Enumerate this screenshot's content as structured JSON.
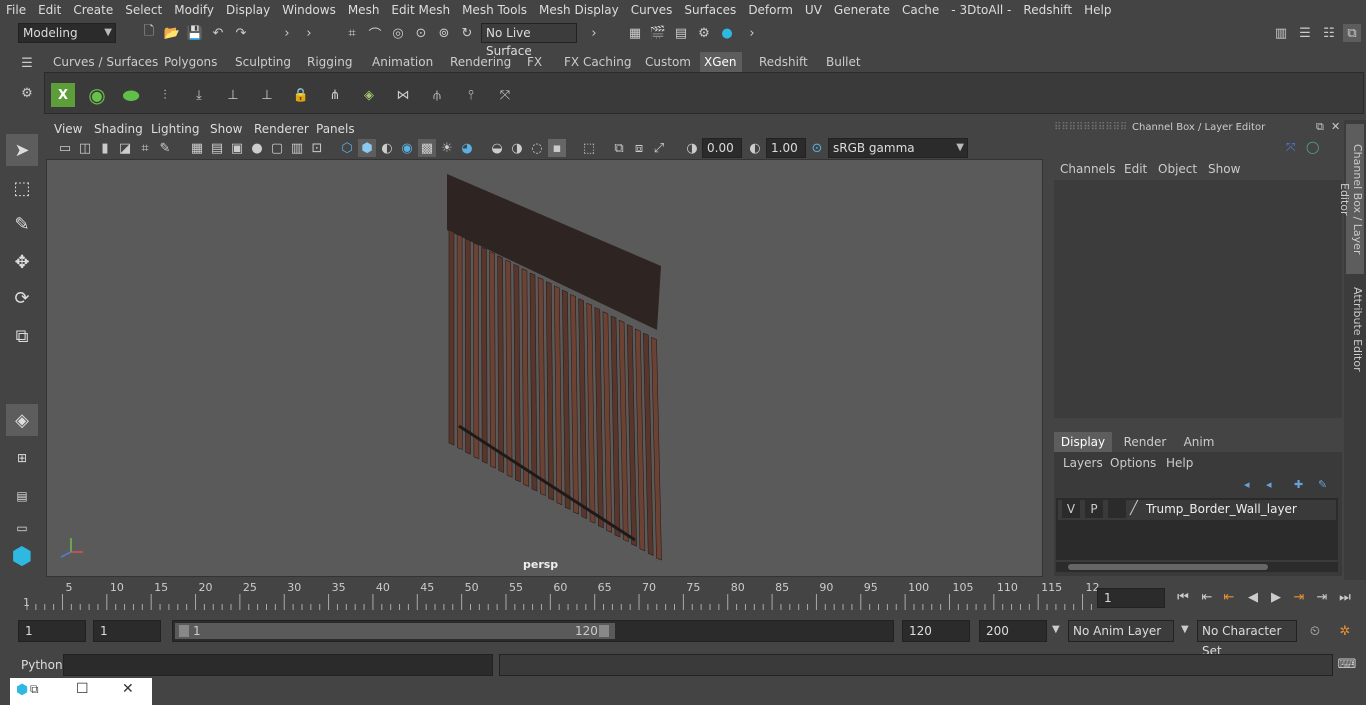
{
  "menubar": [
    "File",
    "Edit",
    "Create",
    "Select",
    "Modify",
    "Display",
    "Windows",
    "Mesh",
    "Edit Mesh",
    "Mesh Tools",
    "Mesh Display",
    "Curves",
    "Surfaces",
    "Deform",
    "UV",
    "Generate",
    "Cache",
    "- 3DtoAll -",
    "Redshift",
    "Help"
  ],
  "status": {
    "mode": "Modeling",
    "live_surface": "No Live Surface"
  },
  "shelf_tabs": [
    "Curves / Surfaces",
    "Polygons",
    "Sculpting",
    "Rigging",
    "Animation",
    "Rendering",
    "FX",
    "FX Caching",
    "Custom",
    "XGen",
    "Redshift",
    "Bullet"
  ],
  "shelf_active": "XGen",
  "viewport": {
    "menus": [
      "View",
      "Shading",
      "Lighting",
      "Show",
      "Renderer",
      "Panels"
    ],
    "exposure": "0.00",
    "gamma": "1.00",
    "color_space": "sRGB gamma",
    "camera_label": "persp"
  },
  "channel_box": {
    "title": "Channel Box / Layer Editor",
    "menus": [
      "Channels",
      "Edit",
      "Object",
      "Show"
    ],
    "layer_tabs": [
      "Display",
      "Render",
      "Anim"
    ],
    "layer_tab_active": "Display",
    "layer_menus": [
      "Layers",
      "Options",
      "Help"
    ],
    "layer": {
      "v": "V",
      "p": "P",
      "name": "Trump_Border_Wall_layer"
    }
  },
  "side_tabs": [
    "Channel Box / Layer Editor",
    "Attribute Editor"
  ],
  "timeline": {
    "ticks": [
      "5",
      "10",
      "15",
      "20",
      "25",
      "30",
      "35",
      "40",
      "45",
      "50",
      "55",
      "60",
      "65",
      "70",
      "75",
      "80",
      "85",
      "90",
      "95",
      "100",
      "105",
      "110",
      "115",
      "12"
    ],
    "start_label": "1",
    "current_frame": "1"
  },
  "range": {
    "start": "1",
    "start2": "1",
    "slider_start": "1",
    "slider_end": "120",
    "end": "120",
    "end2": "200",
    "anim_layer": "No Anim Layer",
    "character_set": "No Character Set"
  },
  "cmdline": {
    "label": "Python"
  }
}
